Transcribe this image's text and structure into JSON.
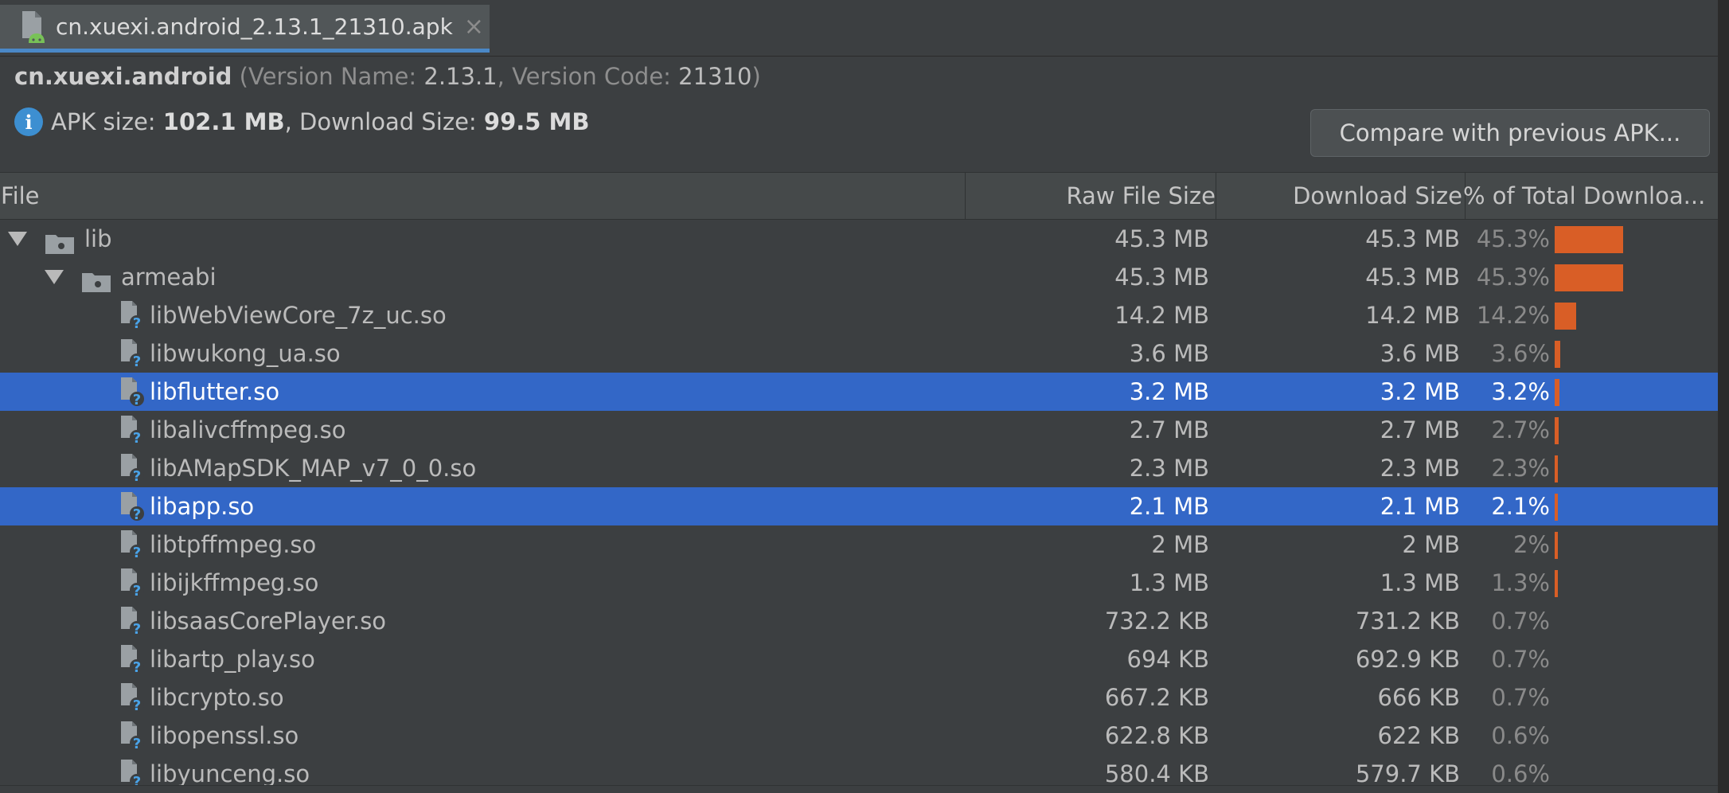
{
  "tab": {
    "label": "cn.xuexi.android_2.13.1_21310.apk",
    "close": "×"
  },
  "header": {
    "package": "cn.xuexi.android",
    "version_name_label": "Version Name:",
    "version_name": "2.13.1",
    "version_code_label": "Version Code:",
    "version_code": "21310",
    "apk_size_label": "APK size:",
    "apk_size": "102.1 MB",
    "download_size_label": "Download Size:",
    "download_size": "99.5 MB",
    "info_icon": "info-icon"
  },
  "compare_button": "Compare with previous APK...",
  "columns": {
    "file": "File",
    "raw": "Raw File Size",
    "download": "Download Size",
    "percent": "% of Total Downloa..."
  },
  "colors": {
    "bar": "#d95e26",
    "selection": "#3367c7",
    "accent": "#4a88c7"
  },
  "rows": [
    {
      "name": "lib",
      "raw": "45.3 MB",
      "download": "45.3 MB",
      "percent": "45.3%",
      "fraction": 0.453,
      "kind": "folder",
      "level": 0,
      "selected": false
    },
    {
      "name": "armeabi",
      "raw": "45.3 MB",
      "download": "45.3 MB",
      "percent": "45.3%",
      "fraction": 0.453,
      "kind": "folder",
      "level": 1,
      "selected": false
    },
    {
      "name": "libWebViewCore_7z_uc.so",
      "raw": "14.2 MB",
      "download": "14.2 MB",
      "percent": "14.2%",
      "fraction": 0.142,
      "kind": "file",
      "level": 2,
      "selected": false
    },
    {
      "name": "libwukong_ua.so",
      "raw": "3.6 MB",
      "download": "3.6 MB",
      "percent": "3.6%",
      "fraction": 0.036,
      "kind": "file",
      "level": 2,
      "selected": false
    },
    {
      "name": "libflutter.so",
      "raw": "3.2 MB",
      "download": "3.2 MB",
      "percent": "3.2%",
      "fraction": 0.032,
      "kind": "file",
      "level": 2,
      "selected": true
    },
    {
      "name": "libalivcffmpeg.so",
      "raw": "2.7 MB",
      "download": "2.7 MB",
      "percent": "2.7%",
      "fraction": 0.027,
      "kind": "file",
      "level": 2,
      "selected": false
    },
    {
      "name": "libAMapSDK_MAP_v7_0_0.so",
      "raw": "2.3 MB",
      "download": "2.3 MB",
      "percent": "2.3%",
      "fraction": 0.023,
      "kind": "file",
      "level": 2,
      "selected": false
    },
    {
      "name": "libapp.so",
      "raw": "2.1 MB",
      "download": "2.1 MB",
      "percent": "2.1%",
      "fraction": 0.021,
      "kind": "file",
      "level": 2,
      "selected": true
    },
    {
      "name": "libtpffmpeg.so",
      "raw": "2 MB",
      "download": "2 MB",
      "percent": "2%",
      "fraction": 0.02,
      "kind": "file",
      "level": 2,
      "selected": false
    },
    {
      "name": "libijkffmpeg.so",
      "raw": "1.3 MB",
      "download": "1.3 MB",
      "percent": "1.3%",
      "fraction": 0.013,
      "kind": "file",
      "level": 2,
      "selected": false
    },
    {
      "name": "libsaasCorePlayer.so",
      "raw": "732.2 KB",
      "download": "731.2 KB",
      "percent": "0.7%",
      "fraction": 0.0,
      "kind": "file",
      "level": 2,
      "selected": false
    },
    {
      "name": "libartp_play.so",
      "raw": "694 KB",
      "download": "692.9 KB",
      "percent": "0.7%",
      "fraction": 0.0,
      "kind": "file",
      "level": 2,
      "selected": false
    },
    {
      "name": "libcrypto.so",
      "raw": "667.2 KB",
      "download": "666 KB",
      "percent": "0.7%",
      "fraction": 0.0,
      "kind": "file",
      "level": 2,
      "selected": false
    },
    {
      "name": "libopenssl.so",
      "raw": "622.8 KB",
      "download": "622 KB",
      "percent": "0.6%",
      "fraction": 0.0,
      "kind": "file",
      "level": 2,
      "selected": false
    },
    {
      "name": "libyunceng.so",
      "raw": "580.4 KB",
      "download": "579.7 KB",
      "percent": "0.6%",
      "fraction": 0.0,
      "kind": "file",
      "level": 2,
      "selected": false
    }
  ]
}
